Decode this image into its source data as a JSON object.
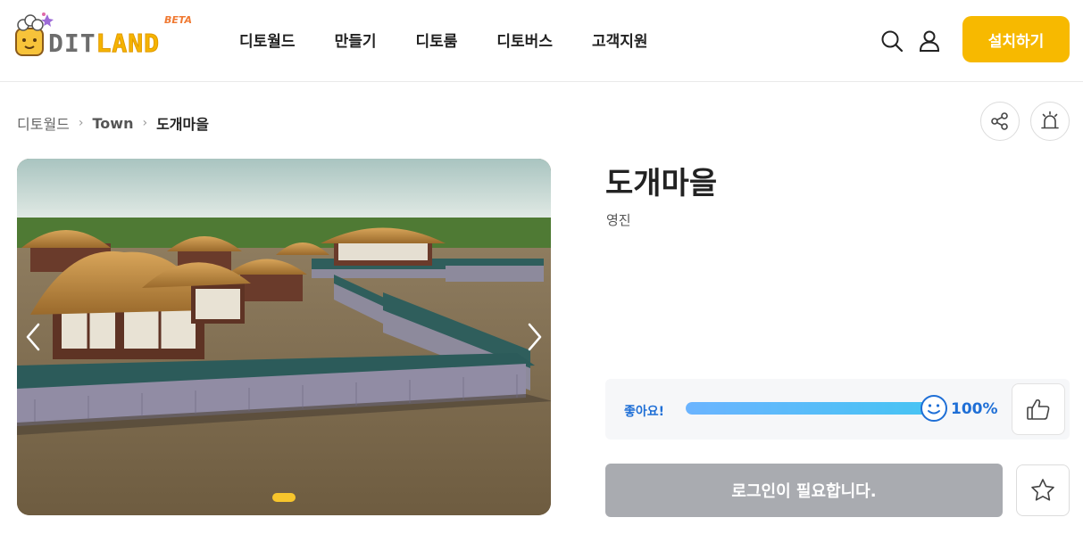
{
  "header": {
    "logo": {
      "text_dit": "DIT",
      "text_land": "LAND",
      "badge": "BETA"
    },
    "nav": [
      {
        "label": "디토월드"
      },
      {
        "label": "만들기"
      },
      {
        "label": "디토룸"
      },
      {
        "label": "디토버스"
      },
      {
        "label": "고객지원"
      }
    ],
    "icons": {
      "search": "search-icon",
      "user": "user-icon"
    },
    "install_label": "설치하기",
    "accent_color": "#f7b900"
  },
  "breadcrumb": {
    "items": [
      "디토월드",
      "Town",
      "도개마을"
    ],
    "separator": "›"
  },
  "actions": {
    "share": "share-icon",
    "report": "siren-icon"
  },
  "carousel": {
    "slide_count": 1,
    "active_slide": 1,
    "prev": "chevron-left-icon",
    "next": "chevron-right-icon"
  },
  "world": {
    "title": "도개마을",
    "author": "영진"
  },
  "like": {
    "label": "좋아요!",
    "percent": 100,
    "percent_text": "100%",
    "face_icon": "smile-icon",
    "thumb_icon": "thumbs-up-icon"
  },
  "login": {
    "label": "로그인이 필요합니다."
  },
  "favorite": {
    "icon": "star-icon"
  }
}
